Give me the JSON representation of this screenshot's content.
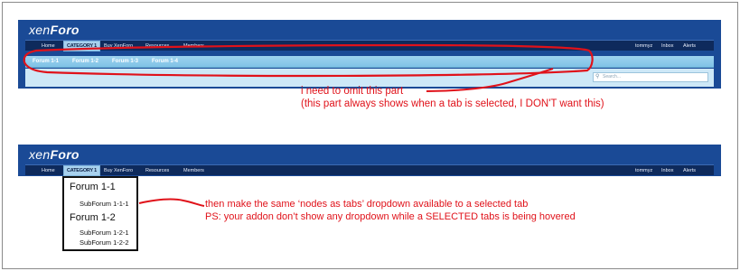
{
  "panel_top": {
    "logo": {
      "main": "xen",
      "accent": "Foro"
    },
    "nav_left": [
      "Home",
      "CATEGORY 1",
      "Buy XenForo",
      "Resources",
      "Members"
    ],
    "nav_right": [
      "tommyz",
      "Inbox",
      "Alerts"
    ],
    "selected_tab": "CATEGORY 1",
    "subtabs": [
      "Forum 1-1",
      "Forum 1-2",
      "Forum 1-3",
      "Forum 1-4"
    ],
    "search_placeholder": "Search..."
  },
  "panel_bottom": {
    "logo": {
      "main": "xen",
      "accent": "Foro"
    },
    "nav_left": [
      "Home",
      "CATEGORY 1",
      "Buy XenForo",
      "Resources",
      "Members"
    ],
    "nav_right": [
      "tommyz",
      "Inbox",
      "Alerts"
    ]
  },
  "annotation_top": {
    "line1": "i need to omit this part",
    "line2": "(this part always shows when a tab is selected, I DON'T want this)"
  },
  "dropdown": {
    "items": [
      {
        "label": "Forum 1-1",
        "children": [
          "SubForum 1-1-1"
        ]
      },
      {
        "label": "Forum 1-2",
        "children": [
          "SubForum 1-2-1",
          "SubForum 1-2-2"
        ]
      }
    ]
  },
  "annotation_bottom": {
    "line1": "then make the same ‘nodes as tabs’ dropdown available to a selected tab",
    "line2": "PS: your addon don’t show any dropdown while a SELECTED tabs is being hovered"
  },
  "colors": {
    "panel_blue": "#1a4a96",
    "nav_dark": "#0e2a5c",
    "selected_tab": "#a8d1ee",
    "annotation_red": "#e0121a"
  }
}
